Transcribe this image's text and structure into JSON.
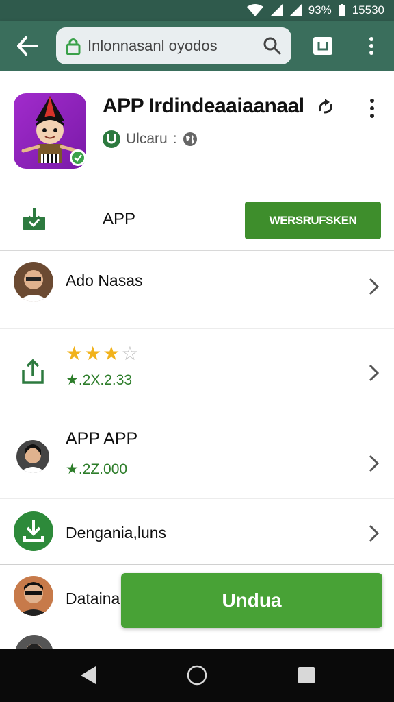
{
  "status_bar": {
    "battery": "93%",
    "time": "15530"
  },
  "browser": {
    "url": "Inlonnasanl oyodos",
    "icons": [
      "back-arrow-icon",
      "lock-icon",
      "search-icon",
      "tabs-icon",
      "more-vert-icon"
    ]
  },
  "app": {
    "title": "APP Irdindeaaiaanaal",
    "developer": "Ulcaru",
    "developer_suffix": ":",
    "row_label": "APP",
    "install_label": "WERSRUFSKEN",
    "accent_color": "#3e8e2c"
  },
  "list": [
    {
      "title": "Ado Nasas",
      "subtitle": ""
    },
    {
      "title": "",
      "rating": 3,
      "max_rating": 4,
      "subtitle": "2X.2.33"
    },
    {
      "title": "APP APP",
      "subtitle": "2Z.000"
    },
    {
      "title": "Dengania,luns",
      "subtitle": ""
    },
    {
      "title": "Dataina",
      "subtitle": ""
    }
  ],
  "download_button": {
    "label": "Undua",
    "color": "#48a236"
  },
  "nav": {
    "icons": [
      "back-triangle-icon",
      "home-circle-icon",
      "recents-square-icon"
    ]
  }
}
